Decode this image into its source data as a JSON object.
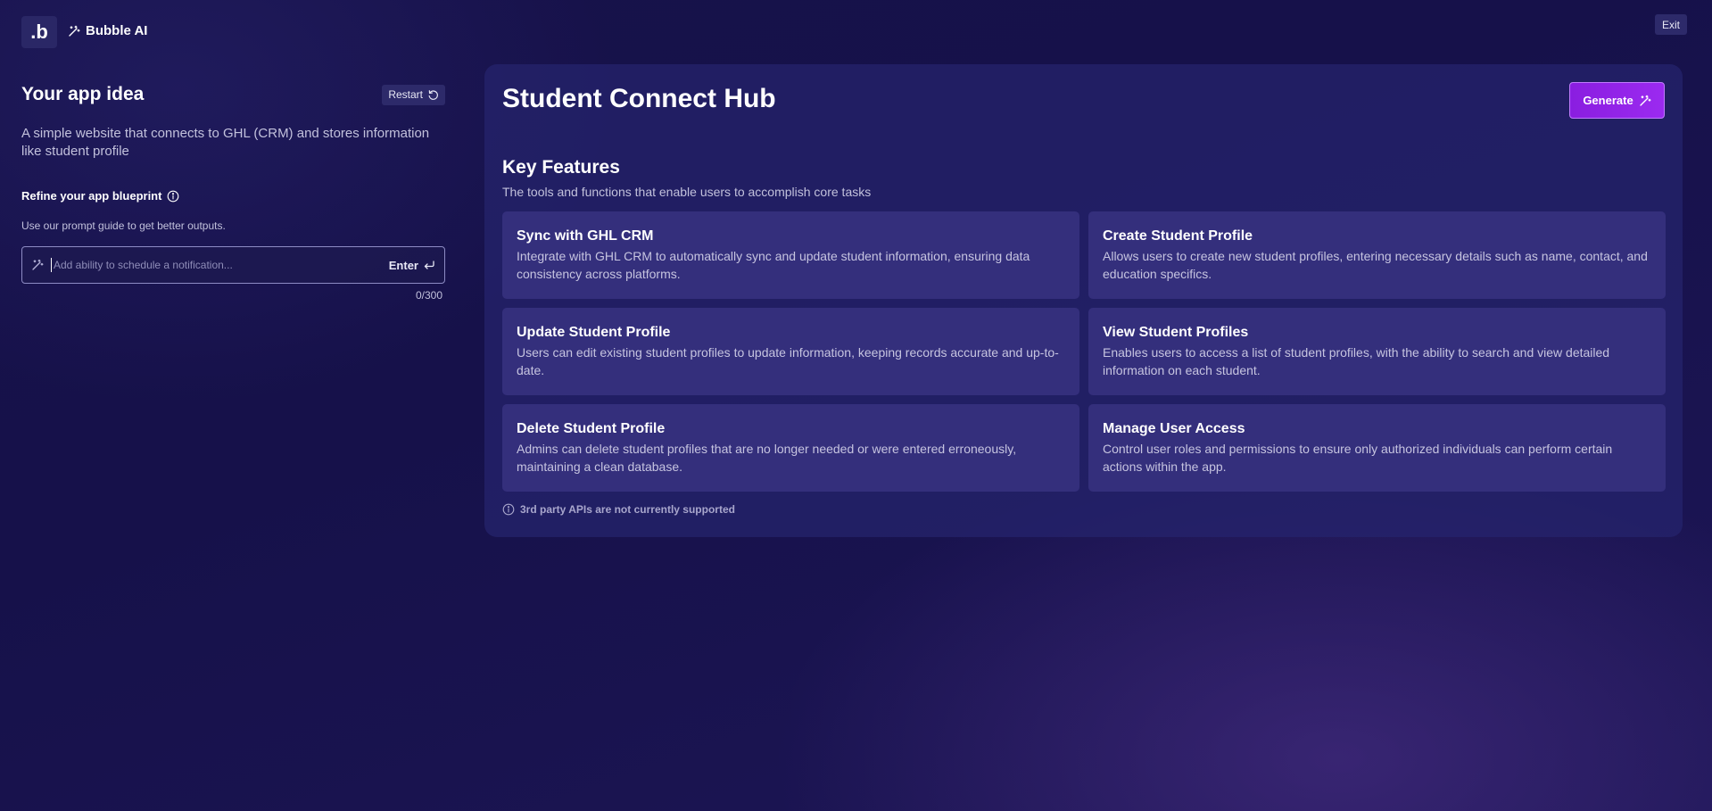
{
  "header": {
    "logo_text": ".b",
    "brand_label": "Bubble AI",
    "brand_icon": "magic-wand-icon",
    "exit_label": "Exit"
  },
  "left_panel": {
    "title": "Your app idea",
    "restart_label": "Restart",
    "restart_icon": "restart-icon",
    "idea_text": "A simple website that connects to GHL (CRM) and stores information like student profile",
    "refine_label": "Refine your app blueprint",
    "refine_icon": "info-icon",
    "hint": "Use our prompt guide to get better outputs.",
    "prompt": {
      "placeholder": "Add ability to schedule a notification...",
      "value": "",
      "enter_label": "Enter",
      "enter_icon": "enter-arrow-icon",
      "counter": "0/300"
    }
  },
  "main": {
    "app_title": "Student Connect Hub",
    "generate_label": "Generate",
    "key_features": {
      "title": "Key Features",
      "subtitle": "The tools and functions that enable users to accomplish core tasks",
      "items": [
        {
          "title": "Sync with GHL CRM",
          "desc": "Integrate with GHL CRM to automatically sync and update student information, ensuring data consistency across platforms."
        },
        {
          "title": "Create Student Profile",
          "desc": "Allows users to create new student profiles, entering necessary details such as name, contact, and education specifics."
        },
        {
          "title": "Update Student Profile",
          "desc": "Users can edit existing student profiles to update information, keeping records accurate and up-to-date."
        },
        {
          "title": "View Student Profiles",
          "desc": "Enables users to access a list of student profiles, with the ability to search and view detailed information on each student."
        },
        {
          "title": "Delete Student Profile",
          "desc": "Admins can delete student profiles that are no longer needed or were entered erroneously, maintaining a clean database."
        },
        {
          "title": "Manage User Access",
          "desc": "Control user roles and permissions to ensure only authorized individuals can perform certain actions within the app."
        }
      ]
    },
    "api_note": "3rd party APIs are not currently supported"
  },
  "colors": {
    "background": "#17124a",
    "card": "#26246e",
    "feature_card": "#342f7c",
    "accent": "#9b2af0"
  }
}
